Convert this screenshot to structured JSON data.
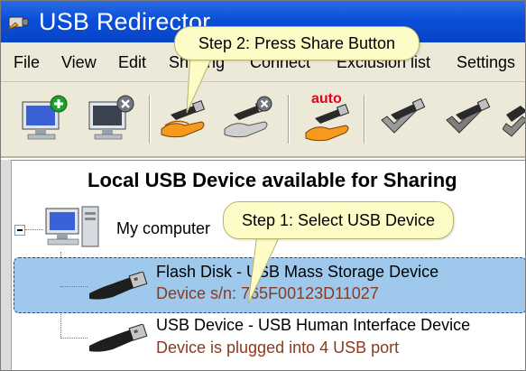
{
  "window": {
    "title": "USB Redirector"
  },
  "menu": {
    "items": [
      "File",
      "View",
      "Edit",
      "Sharing",
      "Connect",
      "Exclusion list",
      "Settings"
    ]
  },
  "toolbar": {
    "buttons": [
      {
        "name": "add-remote-computer",
        "icon": "monitor-plus-icon"
      },
      {
        "name": "remove-remote-computer",
        "icon": "monitor-x-icon"
      },
      {
        "name": "share-device",
        "icon": "usb-hand-share-icon"
      },
      {
        "name": "unshare-device",
        "icon": "usb-hand-unshare-icon"
      },
      {
        "name": "auto-share",
        "icon": "usb-hand-auto-icon"
      },
      {
        "name": "connect-device",
        "icon": "usb-check-icon"
      },
      {
        "name": "disconnect-device",
        "icon": "usb-check-grey-icon"
      },
      {
        "name": "more",
        "icon": "usb-partial-icon"
      }
    ],
    "auto_label": "auto"
  },
  "panel": {
    "title": "Local USB Device available for Sharing",
    "computer_label": "My computer",
    "devices": [
      {
        "name": "Flash Disk - USB Mass Storage Device",
        "detail": "Device s/n: 765F00123D11027",
        "selected": true
      },
      {
        "name": "USB Device - USB Human Interface Device",
        "detail": "Device is plugged into 4 USB port",
        "selected": false
      }
    ]
  },
  "callouts": {
    "step2": "Step 2: Press Share Button",
    "step1": "Step 1: Select USB Device"
  },
  "colors": {
    "titlebar": "#0a4fd8",
    "selection": "#9ec9ec",
    "callout": "#fdfbc6",
    "detail_text": "#8b3a1e",
    "auto_text": "#e8001c"
  }
}
